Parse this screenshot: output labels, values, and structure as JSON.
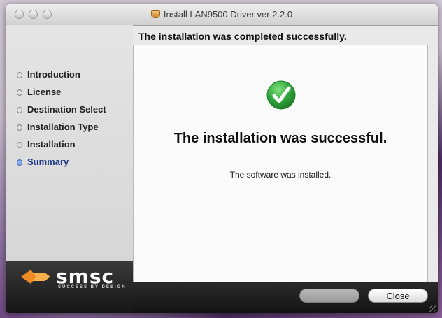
{
  "window": {
    "title": "Install LAN9500 Driver ver 2.2.0"
  },
  "header": {
    "status": "The installation was completed successfully."
  },
  "sidebar": {
    "steps": [
      {
        "label": "Introduction",
        "active": false
      },
      {
        "label": "License",
        "active": false
      },
      {
        "label": "Destination Select",
        "active": false
      },
      {
        "label": "Installation Type",
        "active": false
      },
      {
        "label": "Installation",
        "active": false
      },
      {
        "label": "Summary",
        "active": true
      }
    ]
  },
  "main": {
    "success_title": "The installation was successful.",
    "success_message": "The software was installed."
  },
  "logo": {
    "name": "smsc",
    "tagline": "SUCCESS BY DESIGN"
  },
  "buttons": {
    "back_label": "",
    "close_label": "Close"
  },
  "icons": {
    "package": "package-icon",
    "success": "checkmark-circle-icon"
  },
  "colors": {
    "success_green": "#2ea43a",
    "active_step": "#1e3a8a",
    "logo_orange": "#f08a24"
  }
}
